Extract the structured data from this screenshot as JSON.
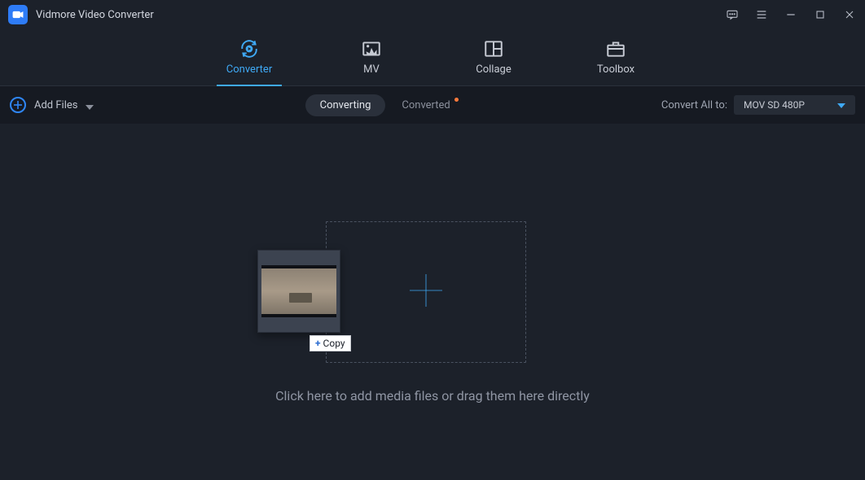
{
  "app": {
    "title": "Vidmore Video Converter"
  },
  "nav": {
    "converter": "Converter",
    "mv": "MV",
    "collage": "Collage",
    "toolbox": "Toolbox"
  },
  "toolbar": {
    "add_files": "Add Files",
    "converting": "Converting",
    "converted": "Converted",
    "convert_all_to": "Convert All to:",
    "format_value": "MOV SD 480P"
  },
  "dropzone": {
    "hint": "Click here to add media files or drag them here directly",
    "copy_badge": "Copy"
  }
}
